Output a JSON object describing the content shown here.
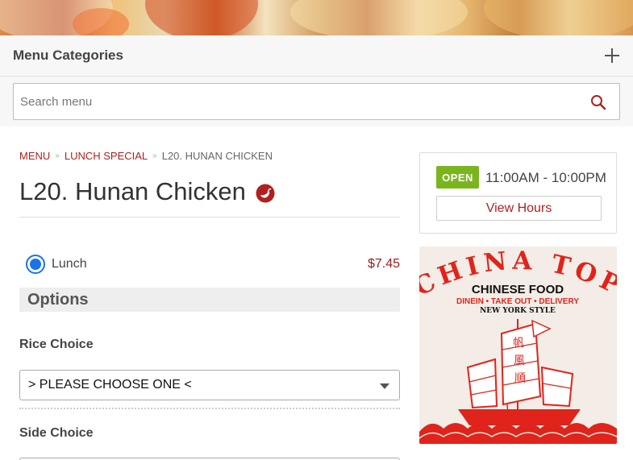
{
  "header": {
    "menu_categories": "Menu Categories"
  },
  "search": {
    "placeholder": "Search menu"
  },
  "breadcrumb": {
    "menu": "MENU",
    "category": "LUNCH SPECIAL",
    "current": "L20. HUNAN CHICKEN"
  },
  "item": {
    "title": "L20. Hunan Chicken",
    "spicy_icon": "chili-pepper-icon",
    "size_label": "Lunch",
    "size_selected": true,
    "price": "$7.45"
  },
  "options": {
    "heading": "Options",
    "rice_choice_label": "Rice Choice",
    "rice_choice_value": "> PLEASE CHOOSE ONE <",
    "side_choice_label": "Side Choice"
  },
  "hours": {
    "status": "OPEN",
    "time": "11:00AM - 10:00PM",
    "view_hours": "View Hours"
  },
  "logo": {
    "name": "CHINA TOP",
    "subtitle": "CHINESE FOOD",
    "services": "DINEIN • TAKE OUT • DELIVERY",
    "style": "NEW YORK STYLE",
    "sail_text_1": "帆",
    "sail_text_2": "風",
    "sail_text_3": "順"
  },
  "colors": {
    "accent_red": "#b11f1f",
    "open_green": "#7ab51d",
    "radio_blue": "#1a73e8"
  }
}
